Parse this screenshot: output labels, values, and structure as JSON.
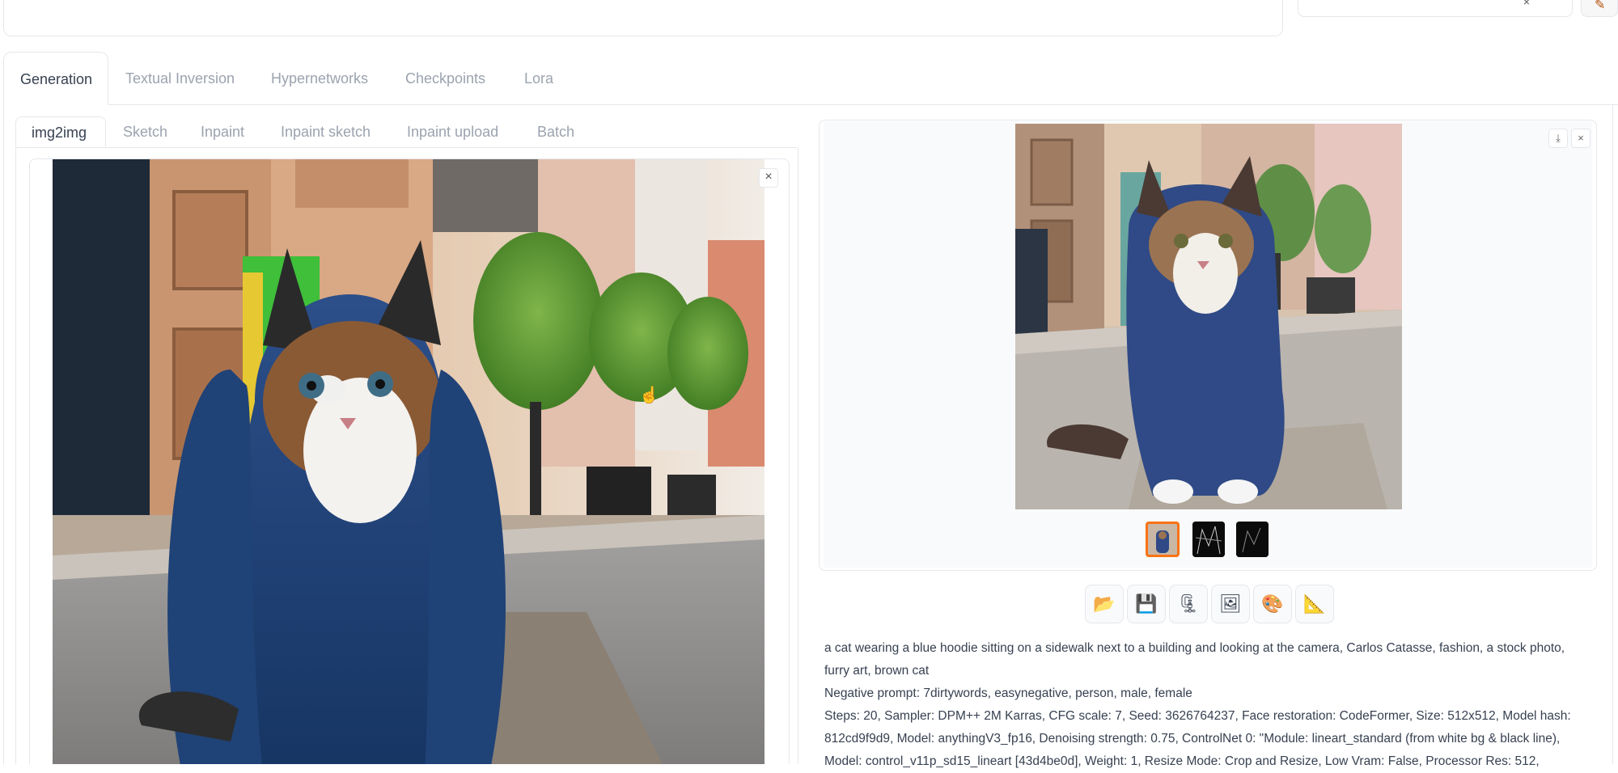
{
  "top": {
    "close_glyph": "×",
    "brush_icon": "paint-brush-icon"
  },
  "main_tabs": [
    {
      "label": "Generation",
      "active": true
    },
    {
      "label": "Textual Inversion",
      "active": false
    },
    {
      "label": "Hypernetworks",
      "active": false
    },
    {
      "label": "Checkpoints",
      "active": false
    },
    {
      "label": "Lora",
      "active": false
    }
  ],
  "sub_tabs": [
    {
      "label": "img2img",
      "active": true
    },
    {
      "label": "Sketch",
      "active": false
    },
    {
      "label": "Inpaint",
      "active": false
    },
    {
      "label": "Inpaint sketch",
      "active": false
    },
    {
      "label": "Inpaint upload",
      "active": false
    },
    {
      "label": "Batch",
      "active": false
    }
  ],
  "input_image": {
    "close_glyph": "×",
    "subject": "cat in blue hoodie photo"
  },
  "output": {
    "download_glyph": "⤓",
    "close_glyph": "×",
    "thumbnails": 3,
    "selected_thumbnail": 1
  },
  "toolbar": [
    {
      "name": "open-folder-icon",
      "glyph": "📂"
    },
    {
      "name": "save-icon",
      "glyph": "💾"
    },
    {
      "name": "zip-icon",
      "glyph": "🗜"
    },
    {
      "name": "send-to-img2img-icon",
      "glyph": "🖼"
    },
    {
      "name": "send-to-inpaint-icon",
      "glyph": "🎨"
    },
    {
      "name": "send-to-extras-icon",
      "glyph": "📐"
    }
  ],
  "info": {
    "prompt": "a cat wearing a blue hoodie sitting on a sidewalk next to a building and looking at the camera, Carlos Catasse, fashion, a stock photo, furry art, brown cat",
    "negative": "Negative prompt: 7dirtywords, easynegative, person, male, female",
    "params": "Steps: 20, Sampler: DPM++ 2M Karras, CFG scale: 7, Seed: 3626764237, Face restoration: CodeFormer, Size: 512x512, Model hash: 812cd9f9d9, Model: anythingV3_fp16, Denoising strength: 0.75, ControlNet 0: \"Module: lineart_standard (from white bg & black line), Model: control_v11p_sd15_lineart [43d4be0d], Weight: 1, Resize Mode: Crop and Resize, Low Vram: False, Processor Res: 512,"
  }
}
